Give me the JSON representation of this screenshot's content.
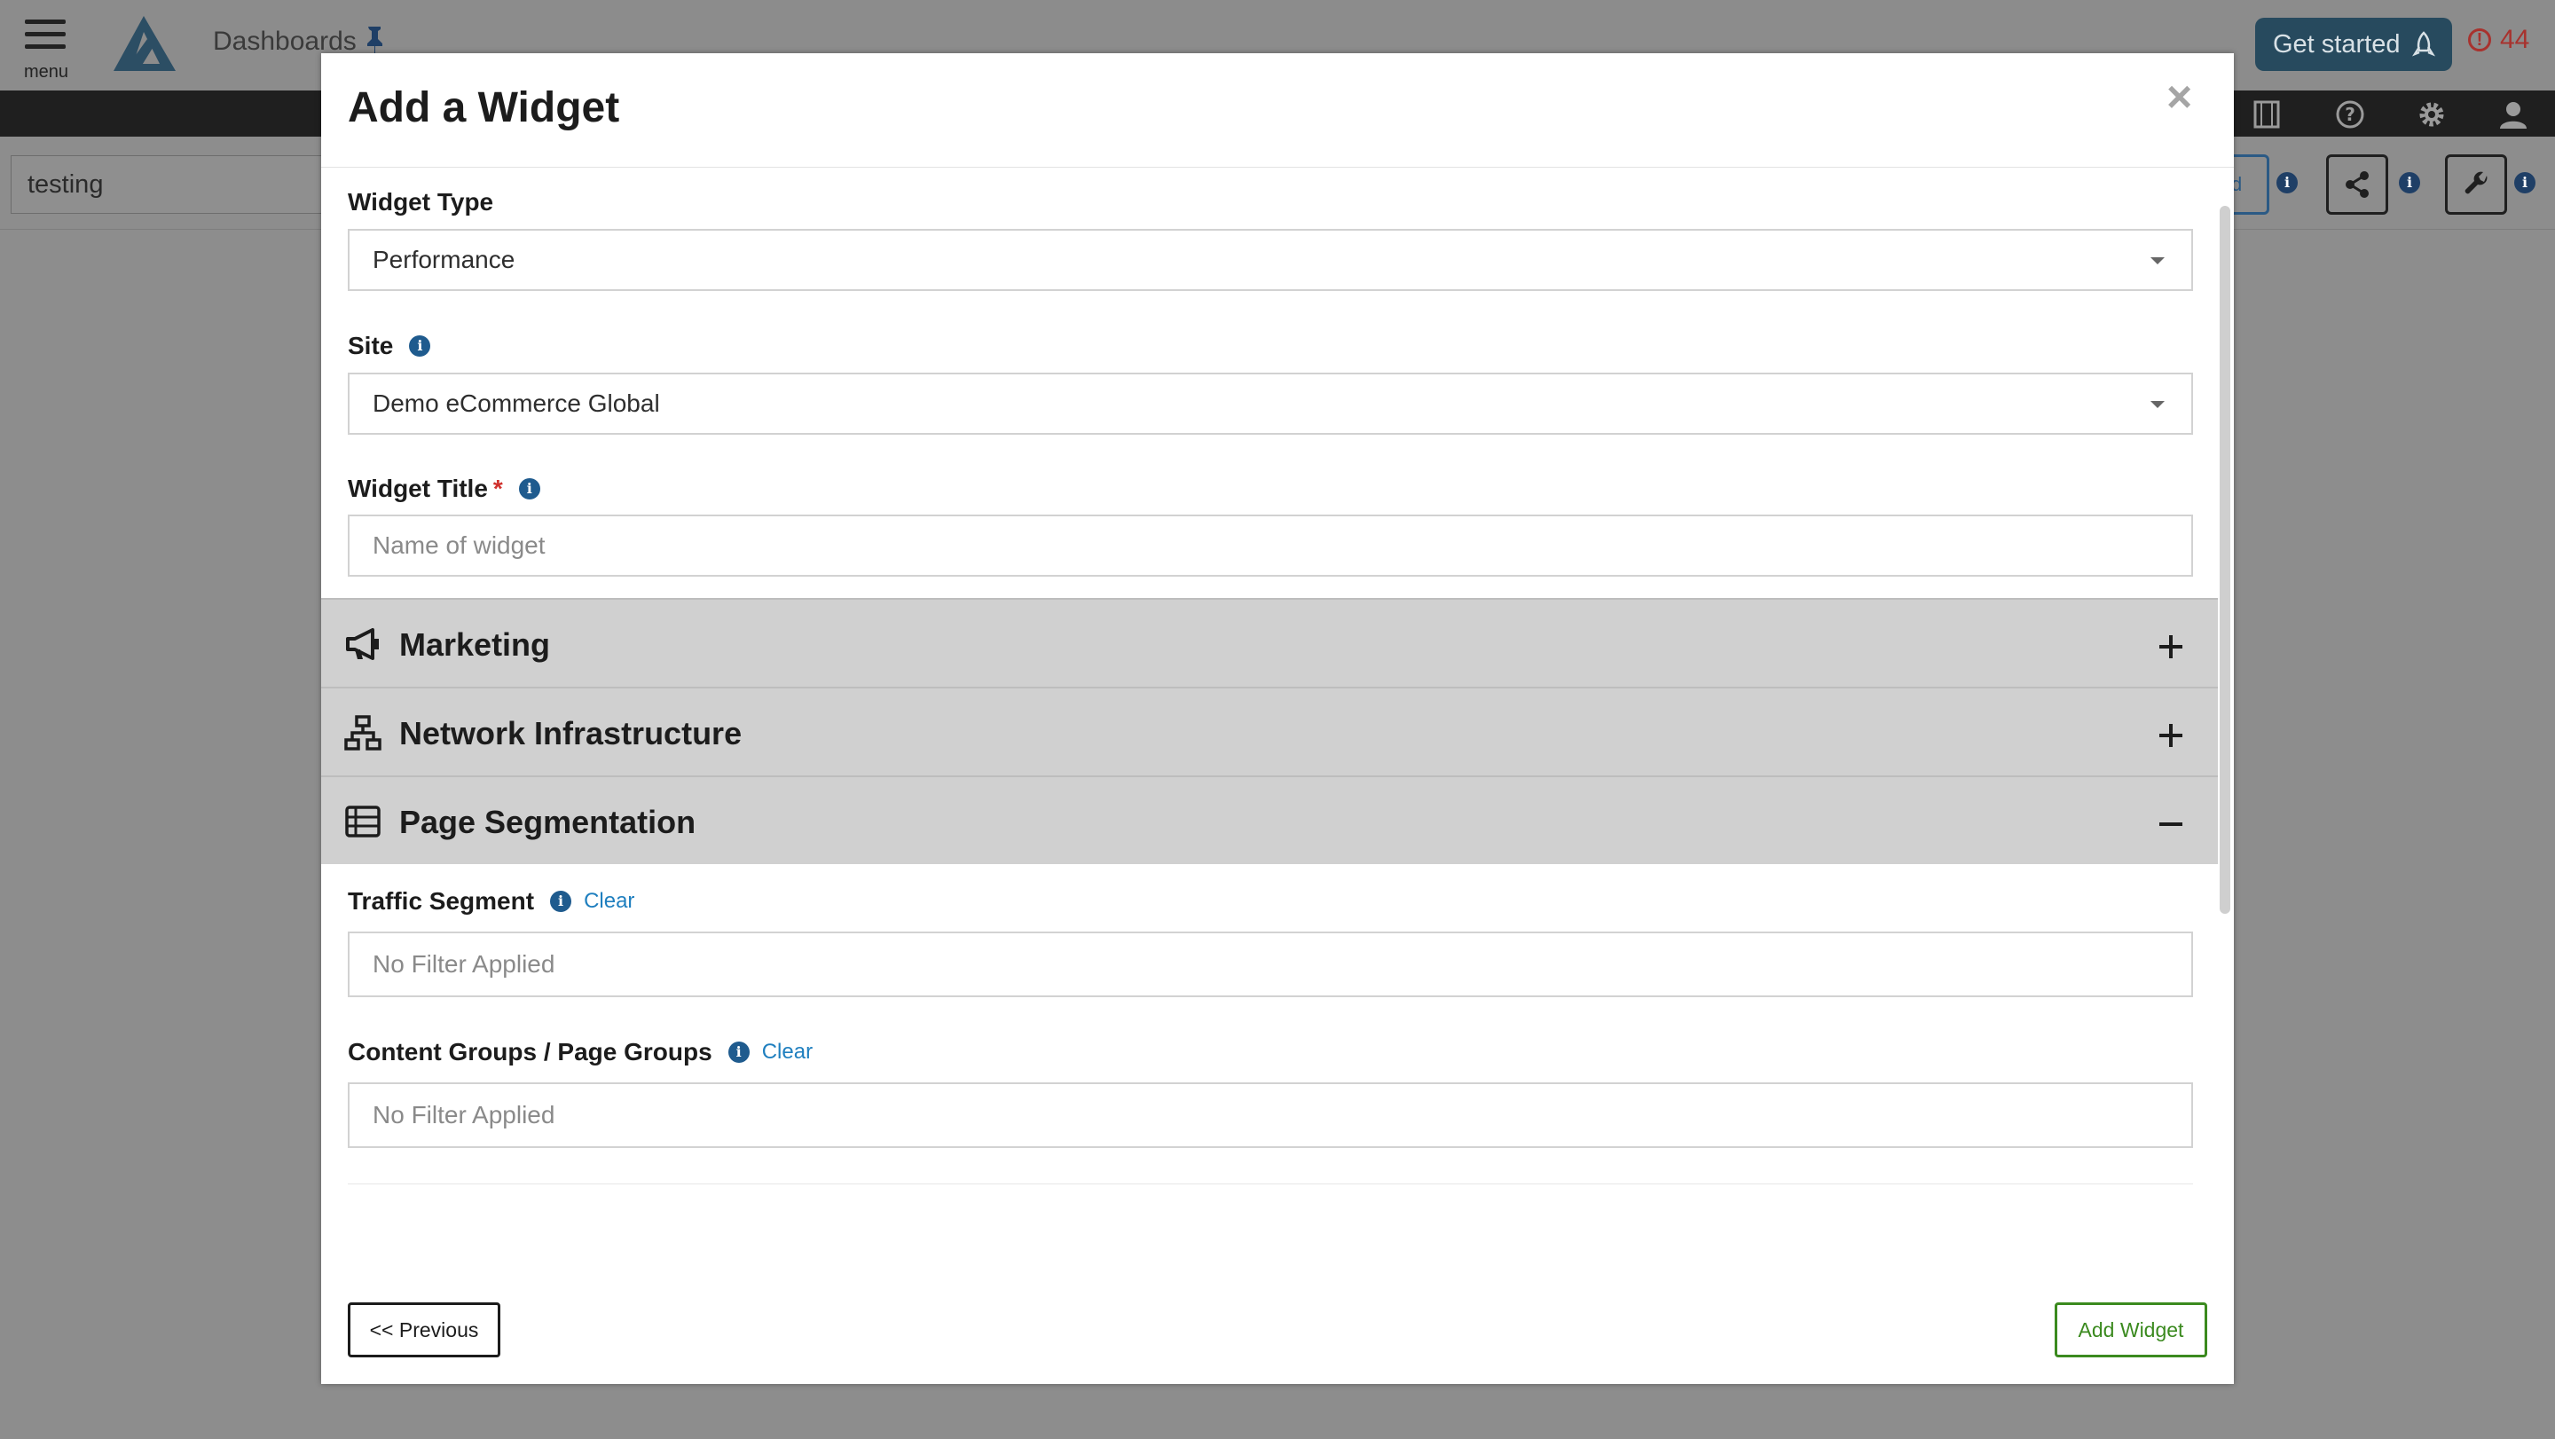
{
  "app": {
    "menu_label": "menu",
    "breadcrumb": "Dashboards",
    "get_started_label": "Get started",
    "alert_count": "44",
    "dashboard_name": "testing",
    "partial_button_text": "d"
  },
  "modal": {
    "title": "Add a Widget",
    "close_label": "×",
    "widget_type": {
      "label": "Widget Type",
      "value": "Performance"
    },
    "site": {
      "label": "Site",
      "value": "Demo eCommerce Global"
    },
    "widget_title": {
      "label": "Widget Title",
      "required_mark": "*",
      "value": "",
      "placeholder": "Name of widget"
    },
    "sections": [
      {
        "title": "Marketing",
        "icon": "bullhorn-icon",
        "expanded": false
      },
      {
        "title": "Network Infrastructure",
        "icon": "network-icon",
        "expanded": false
      },
      {
        "title": "Page Segmentation",
        "icon": "list-table-icon",
        "expanded": true
      }
    ],
    "traffic_segment": {
      "label": "Traffic Segment",
      "clear_label": "Clear",
      "value": "No Filter Applied"
    },
    "content_groups": {
      "label": "Content Groups / Page Groups",
      "clear_label": "Clear",
      "value": "No Filter Applied"
    },
    "info_glyph": "i",
    "previous_label": "<< Previous",
    "add_label": "Add Widget"
  },
  "colors": {
    "overlay": "#8d8d8d",
    "section_bg": "#d0d0d0",
    "link": "#1f7fbf",
    "add_button": "#3b8a1f",
    "get_started_bg": "#274a5e",
    "alert": "#a8322e"
  }
}
